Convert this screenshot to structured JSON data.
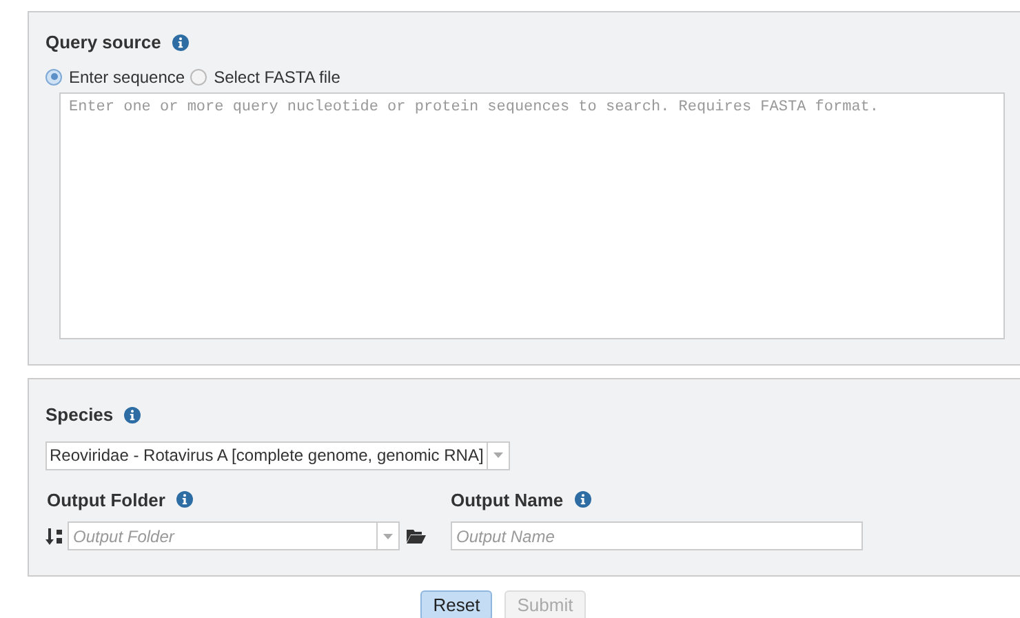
{
  "query_source": {
    "title": "Query source",
    "options": [
      {
        "label": "Enter sequence",
        "selected": true
      },
      {
        "label": "Select FASTA file",
        "selected": false
      }
    ],
    "sequence": {
      "placeholder": "Enter one or more query nucleotide or protein sequences to search. Requires FASTA format."
    }
  },
  "species": {
    "title": "Species",
    "value": "Reoviridae - Rotavirus A [complete genome, genomic RNA]"
  },
  "output_folder": {
    "title": "Output Folder",
    "placeholder": "Output Folder"
  },
  "output_name": {
    "title": "Output Name",
    "placeholder": "Output Name"
  },
  "buttons": [
    {
      "label": "Reset",
      "disabled": false
    },
    {
      "label": "Submit",
      "disabled": true
    }
  ]
}
